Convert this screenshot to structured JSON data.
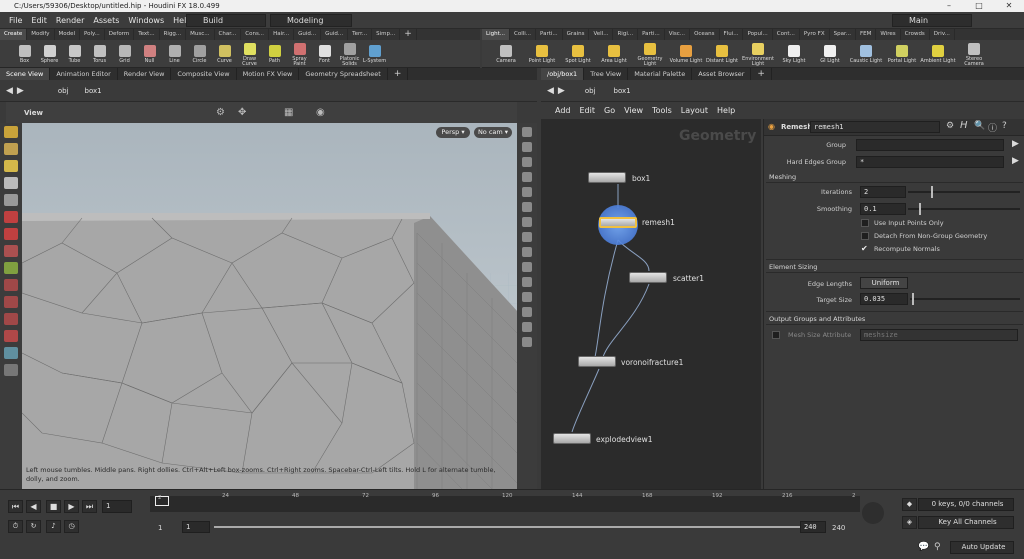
{
  "window": {
    "title": "C:/Users/59306/Desktop/untitled.hip - Houdini FX 18.0.499",
    "minimize": "–",
    "maximize": "□",
    "close": "✕"
  },
  "menu": {
    "items": [
      "File",
      "Edit",
      "Render",
      "Assets",
      "Windows",
      "Help"
    ],
    "build_label": "Build",
    "modeling_label": "Modeling",
    "main_label": "Main"
  },
  "shelf_left": {
    "tabs": [
      "Create",
      "Modify",
      "Model",
      "Poly...",
      "Deform",
      "Text...",
      "Rigg...",
      "Musc...",
      "Char...",
      "Cons...",
      "Hair...",
      "Guid...",
      "Guid...",
      "Terr...",
      "Simp..."
    ],
    "tools": [
      "Box",
      "Sphere",
      "Tube",
      "Torus",
      "Grid",
      "Null",
      "Line",
      "Circle",
      "Curve",
      "Draw Curve",
      "Path",
      "Spray Paint",
      "Font",
      "Platonic Solids",
      "L-System"
    ]
  },
  "shelf_right": {
    "tabs": [
      "Light...",
      "Colli...",
      "Parti...",
      "Grains",
      "Vell...",
      "Rigi...",
      "Parti...",
      "Visc...",
      "Oceans",
      "Flui...",
      "Popul...",
      "Cont...",
      "Pyro FX",
      "Spar...",
      "FEM",
      "Wires",
      "Crowds",
      "Driv..."
    ],
    "tools": [
      "Camera",
      "Point Light",
      "Spot Light",
      "Area Light",
      "Geometry Light",
      "Volume Light",
      "Distant Light",
      "Environment Light",
      "Sky Light",
      "GI Light",
      "Caustic Light",
      "Portal Light",
      "Ambient Light",
      "Stereo Camera"
    ]
  },
  "left_pane": {
    "tabs": [
      "Scene View",
      "Animation Editor",
      "Render View",
      "Composite View",
      "Motion FX View",
      "Geometry Spreadsheet"
    ],
    "path": [
      "obj",
      "box1"
    ],
    "view_label": "View",
    "persp": "Persp ▾",
    "nocam": "No cam ▾",
    "help": "Left mouse tumbles. Middle pans. Right dollies. Ctrl+Alt+Left box-zooms. Ctrl+Right zooms. Spacebar-Ctrl-Left tilts. Hold L for alternate tumble, dolly, and zoom."
  },
  "right_pane": {
    "tabs": [
      "/obj/box1",
      "Tree View",
      "Material Palette",
      "Asset Browser"
    ],
    "path": [
      "obj",
      "box1"
    ],
    "net_menu": [
      "Add",
      "Edit",
      "Go",
      "View",
      "Tools",
      "Layout",
      "Help"
    ],
    "watermark": "Geometry",
    "nodes": [
      {
        "name": "box1"
      },
      {
        "name": "remesh1"
      },
      {
        "name": "scatter1"
      },
      {
        "name": "voronoifracture1"
      },
      {
        "name": "explodedview1"
      }
    ]
  },
  "params": {
    "node_type": "Remesh",
    "node_name": "remesh1",
    "group_label": "Group",
    "group_value": "",
    "hard_edges_label": "Hard Edges Group",
    "hard_edges_value": "*",
    "meshing_title": "Meshing",
    "iterations_label": "Iterations",
    "iterations_value": "2",
    "smoothing_label": "Smoothing",
    "smoothing_value": "0.1",
    "use_input_points": "Use Input Points Only",
    "detach": "Detach From Non-Group Geometry",
    "recompute": "Recompute Normals",
    "element_sizing_title": "Element Sizing",
    "edge_lengths_label": "Edge Lengths",
    "edge_lengths_value": "Uniform",
    "target_size_label": "Target Size",
    "target_size_value": "0.035",
    "output_title": "Output Groups and Attributes",
    "mesh_size_attr_label": "Mesh Size Attribute",
    "mesh_size_attr_value": "meshsize"
  },
  "timeline": {
    "ticks": [
      "2",
      "24",
      "48",
      "72",
      "96",
      "120",
      "144",
      "168",
      "192",
      "216",
      "2"
    ],
    "current_frame": "1",
    "range_start": "1",
    "range_start2": "1",
    "range_end": "240",
    "range_end2": "240",
    "keys_info": "0 keys, 0/0 channels",
    "key_all_channels": "Key All Channels",
    "auto_update": "Auto Update"
  }
}
